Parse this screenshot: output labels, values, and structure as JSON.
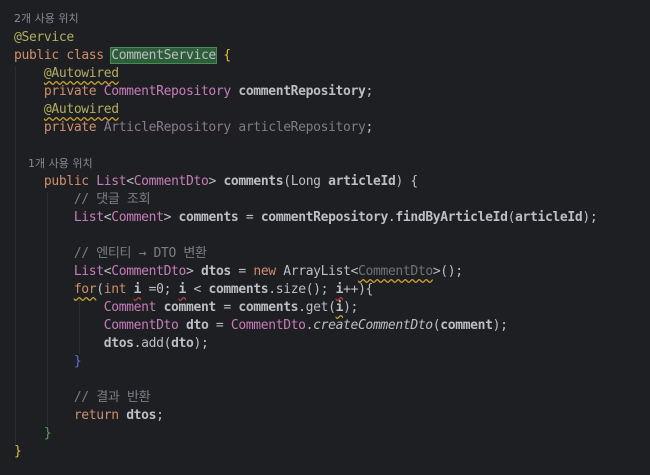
{
  "editor": {
    "language": "java",
    "lines": [
      {
        "text": "2개 사용 위치"
      },
      {
        "text": "@Service"
      },
      {
        "text": "public class CommentService {"
      },
      {
        "text": "    @Autowired"
      },
      {
        "text": "    private CommentRepository commentRepository;"
      },
      {
        "text": "    @Autowired"
      },
      {
        "text": "    private ArticleRepository articleRepository;"
      },
      {
        "text": ""
      },
      {
        "text": "    1개 사용 위치"
      },
      {
        "text": "    public List<CommentDto> comments(Long articleId) {"
      },
      {
        "text": "        // 댓글 조회"
      },
      {
        "text": "        List<Comment> comments = commentRepository.findByArticleId(articleId);"
      },
      {
        "text": ""
      },
      {
        "text": "        // 엔티티 → DTO 변환"
      },
      {
        "text": "        List<CommentDto> dtos = new ArrayList<CommentDto>();"
      },
      {
        "text": "        for(int i =0; i < comments.size(); i++){"
      },
      {
        "text": "            Comment comment = comments.get(i);"
      },
      {
        "text": "            CommentDto dto = CommentDto.createCommentDto(comment);"
      },
      {
        "text": "            dtos.add(dto);"
      },
      {
        "text": "        }"
      },
      {
        "text": ""
      },
      {
        "text": "        // 결과 반환"
      },
      {
        "text": "        return dtos;"
      },
      {
        "text": "    }"
      },
      {
        "text": "}"
      }
    ],
    "tokens": {
      "usage_2": "2개 사용 위치",
      "usage_1": "1개 사용 위치",
      "ann_service": "@Service",
      "ann_autowired": "@Autowired",
      "kw_public": "public",
      "kw_class": "class",
      "kw_private": "private",
      "kw_new": "new",
      "kw_for": "for",
      "kw_int": "int",
      "kw_return": "return",
      "cls_service": "CommentService",
      "cls_comment_repo": "CommentRepository",
      "cls_article_repo": "ArticleRepository",
      "field_comment_repo": "commentRepository",
      "field_article_repo": "articleRepository",
      "type_list": "List",
      "type_comment_dto": "CommentDto",
      "type_comment": "Comment",
      "type_long": "Long",
      "type_arraylist": "ArrayList",
      "fn_comments": "comments",
      "fn_find": "findByArticleId",
      "fn_size": "size",
      "fn_get": "get",
      "fn_create": "createCommentDto",
      "fn_add": "add",
      "var_article_id": "articleId",
      "var_comments": "comments",
      "var_dtos": "dtos",
      "var_i": "i",
      "var_comment": "comment",
      "var_dto": "dto",
      "cmt_1": "// 댓글 조회",
      "cmt_2": "// 엔티티 → DTO 변환",
      "cmt_3": "// 결과 반환"
    }
  },
  "colors": {
    "background": "#1e1f22",
    "keyword": "#cf8e6d",
    "annotation": "#b3ae60",
    "field": "#c77dbb",
    "method": "#56a8f5",
    "comment": "#7a7e85",
    "text": "#bcbec4"
  }
}
